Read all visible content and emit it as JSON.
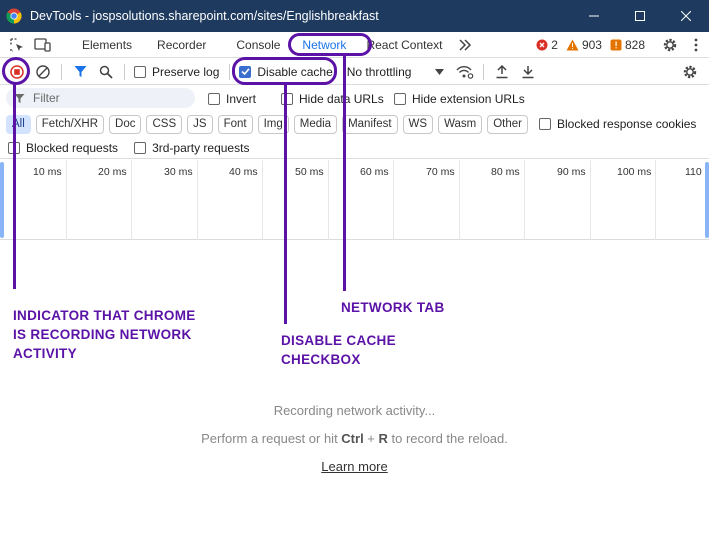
{
  "window": {
    "title": "DevTools - jospsolutions.sharepoint.com/sites/Englishbreakfast"
  },
  "tabs": [
    {
      "label": "Elements"
    },
    {
      "label": "Recorder"
    },
    {
      "label": "Console"
    },
    {
      "label": "Network"
    },
    {
      "label": "React Context"
    }
  ],
  "counts": {
    "errors": "2",
    "warnings": "903",
    "issues": "828"
  },
  "toolbar": {
    "preserve_log": "Preserve log",
    "disable_cache": "Disable cache",
    "throttling": "No throttling"
  },
  "filter": {
    "placeholder": "Filter",
    "invert": "Invert",
    "hide_data_urls": "Hide data URLs",
    "hide_extension_urls": "Hide extension URLs"
  },
  "types": [
    "All",
    "Fetch/XHR",
    "Doc",
    "CSS",
    "JS",
    "Font",
    "Img",
    "Media",
    "Manifest",
    "WS",
    "Wasm",
    "Other"
  ],
  "blocked_response_cookies": "Blocked response cookies",
  "blocked_requests": "Blocked requests",
  "third_party_requests": "3rd-party requests",
  "timeline": {
    "ticks": [
      "10 ms",
      "20 ms",
      "30 ms",
      "40 ms",
      "50 ms",
      "60 ms",
      "70 ms",
      "80 ms",
      "90 ms",
      "100 ms",
      "110"
    ]
  },
  "annotations": {
    "recording": "INDICATOR THAT CHROME\nIS RECORDING NETWORK\nACTIVITY",
    "network_tab": "NETWORK TAB",
    "disable_cache": "DISABLE CACHE\nCHECKBOX",
    "color": "#5b12a6"
  },
  "empty_state": {
    "line1": "Recording network activity...",
    "line2_pre": "Perform a request or hit ",
    "key1": "Ctrl",
    "plus": " + ",
    "key2": "R",
    "line2_post": " to record the reload.",
    "learn_more": "Learn more"
  }
}
